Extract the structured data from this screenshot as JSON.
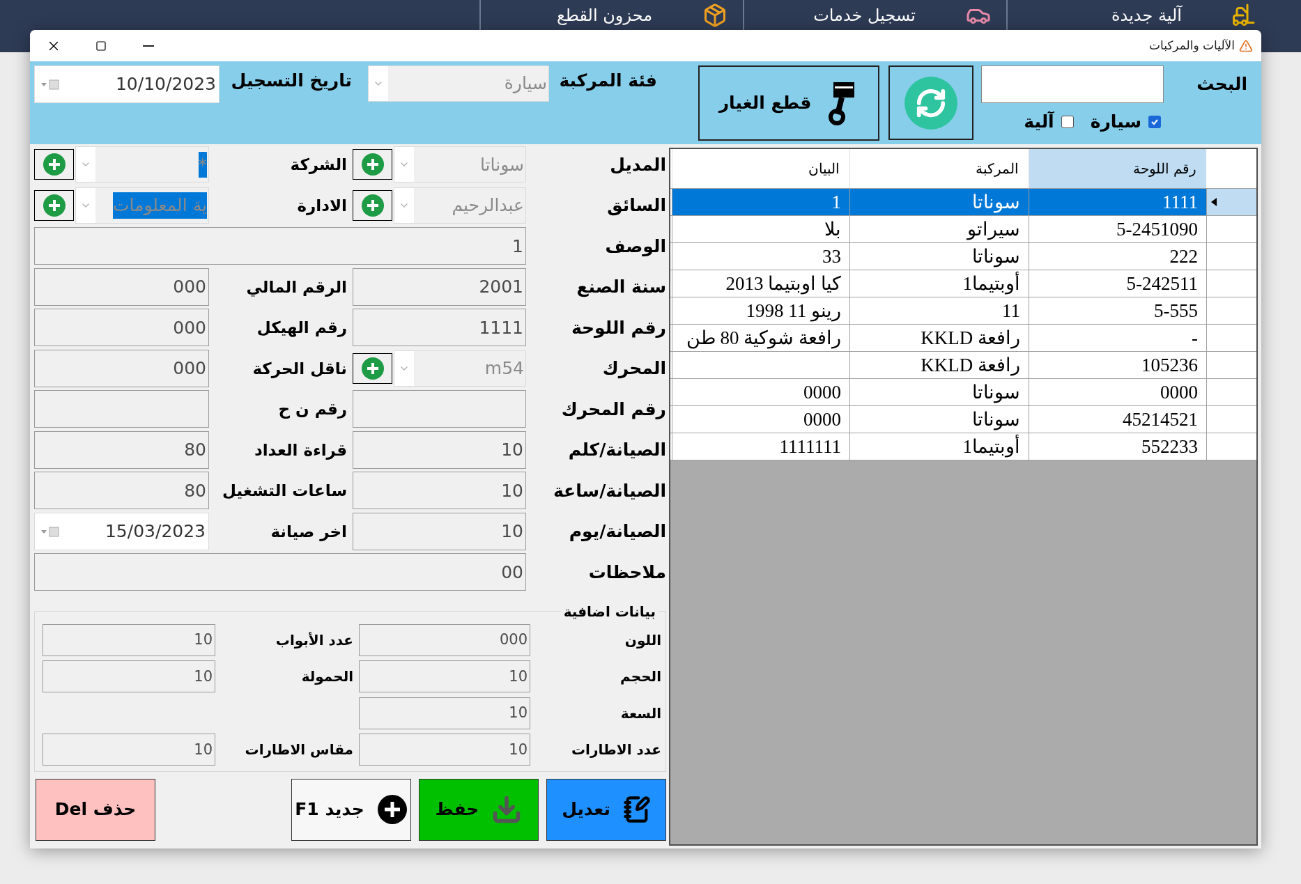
{
  "app_tabs": [
    {
      "label": "آلية جديدة"
    },
    {
      "label": "تسجيل خدمات"
    },
    {
      "label": "محزون القطع"
    }
  ],
  "window": {
    "title": "الآليات والمركبات"
  },
  "toolbar": {
    "search": {
      "label": "البحث"
    },
    "filters": [
      {
        "label": "سيارة",
        "checked": true
      },
      {
        "label": "آلية",
        "checked": false
      }
    ],
    "spare_parts_button": "قطع الغيار",
    "category": {
      "label": "فئة المركبة",
      "value": "سيارة"
    },
    "registration_date": {
      "label": "تاريخ التسجيل",
      "value": "10/10/2023"
    }
  },
  "form": {
    "rows": [
      [
        {
          "label": "المديل",
          "kind": "combo",
          "value": "سوناتا",
          "highlighted": false
        },
        {
          "label": "الشركة",
          "kind": "combo",
          "value": "*",
          "highlighted": true
        }
      ],
      [
        {
          "label": "السائق",
          "kind": "combo",
          "value": "عبدالرحيم",
          "highlighted": false
        },
        {
          "label": "الادارة",
          "kind": "combo",
          "value": "ية المعلومات",
          "highlighted": true
        }
      ],
      [
        {
          "label": "الوصف",
          "kind": "wide",
          "value": "1"
        }
      ],
      [
        {
          "label": "سنة الصنع",
          "kind": "text",
          "value": "2001"
        },
        {
          "label": "الرقم المالي",
          "kind": "text",
          "value": "000"
        }
      ],
      [
        {
          "label": "رقم اللوحة",
          "kind": "text",
          "value": "1111"
        },
        {
          "label": "رقم الهيكل",
          "kind": "text",
          "value": "000"
        }
      ],
      [
        {
          "label": "المحرك",
          "kind": "combo",
          "value": "m54",
          "highlighted": false
        },
        {
          "label": "ناقل الحركة",
          "kind": "text",
          "value": "000"
        }
      ],
      [
        {
          "label": "رقم المحرك",
          "kind": "text"
        },
        {
          "label": "رقم ن ح",
          "kind": "text"
        }
      ],
      [
        {
          "label": "الصيانة/كلم",
          "kind": "text",
          "value": "10"
        },
        {
          "label": "قراءة العداد",
          "kind": "text",
          "value": "80"
        }
      ],
      [
        {
          "label": "الصيانة/ساعة",
          "kind": "text",
          "value": "10"
        },
        {
          "label": "ساعات التشغيل",
          "kind": "text",
          "value": "80"
        }
      ],
      [
        {
          "label": "الصيانة/يوم",
          "kind": "text",
          "value": "10"
        },
        {
          "label": "اخر صيانة",
          "kind": "date",
          "value": "15/03/2023"
        }
      ],
      [
        {
          "label": "ملاحظات",
          "kind": "wide",
          "value": "00"
        }
      ]
    ]
  },
  "extra": {
    "title": "بيانات اضافية",
    "rows": [
      [
        {
          "label": "اللون",
          "value": "000"
        },
        {
          "label": "عدد الأبواب",
          "value": "10"
        }
      ],
      [
        {
          "label": "الحجم",
          "value": "10"
        },
        {
          "label": "الحمولة",
          "value": "10"
        }
      ],
      [
        {
          "label": "السعة",
          "value": "10"
        }
      ],
      [
        {
          "label": "عدد الاطارات",
          "value": "10"
        },
        {
          "label": "مقاس الاطارات",
          "value": "10"
        }
      ]
    ]
  },
  "buttons": [
    {
      "label": "تعديل",
      "kind": "edit"
    },
    {
      "label": "حفظ",
      "kind": "save"
    },
    {
      "label": "جديد F1",
      "kind": "new"
    },
    {
      "label": "حذف Del",
      "kind": "delete"
    }
  ],
  "table": {
    "columns": [
      {
        "label": "رقم اللوحة",
        "selected": true
      },
      {
        "label": "المركبة",
        "selected": false
      },
      {
        "label": "البيان",
        "selected": false
      }
    ],
    "rows": [
      {
        "cells": [
          "1111",
          "سوناتا",
          "1"
        ],
        "selected": true
      },
      {
        "cells": [
          "5-2451090",
          "سيراتو",
          "بلا"
        ],
        "selected": false
      },
      {
        "cells": [
          "222",
          "سوناتا",
          "33"
        ],
        "selected": false
      },
      {
        "cells": [
          "5-242511",
          "أوبتيما1",
          "كيا اوبتيما 2013"
        ],
        "selected": false
      },
      {
        "cells": [
          "5-555",
          "11",
          "رينو 11 1998"
        ],
        "selected": false
      },
      {
        "cells": [
          "-",
          "رافعة KKLD",
          "رافعة شوكية 80 طن"
        ],
        "selected": false
      },
      {
        "cells": [
          "105236",
          "رافعة KKLD",
          null
        ],
        "selected": false
      },
      {
        "cells": [
          "0000",
          "سوناتا",
          "0000"
        ],
        "selected": false
      },
      {
        "cells": [
          "45214521",
          "سوناتا",
          "0000"
        ],
        "selected": false
      },
      {
        "cells": [
          "552233",
          "أوبتيما1",
          "1111111"
        ],
        "selected": false
      }
    ]
  }
}
